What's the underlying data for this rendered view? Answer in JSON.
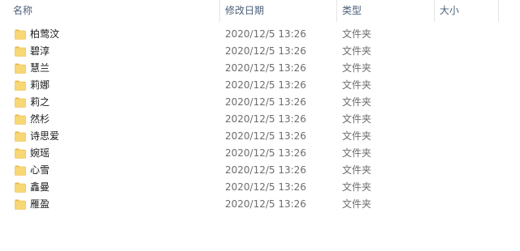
{
  "columns": {
    "name": "名称",
    "modified": "修改日期",
    "type": "类型",
    "size": "大小"
  },
  "colors": {
    "header_text": "#4c607a",
    "folder_body": "#f8d775",
    "folder_tab": "#e8b84a"
  },
  "rows": [
    {
      "name": "柏莺汶",
      "modified": "2020/12/5 13:26",
      "type": "文件夹",
      "icon": "folder-icon"
    },
    {
      "name": "碧淳",
      "modified": "2020/12/5 13:26",
      "type": "文件夹",
      "icon": "folder-icon"
    },
    {
      "name": "慧兰",
      "modified": "2020/12/5 13:26",
      "type": "文件夹",
      "icon": "folder-icon"
    },
    {
      "name": "莉娜",
      "modified": "2020/12/5 13:26",
      "type": "文件夹",
      "icon": "folder-icon"
    },
    {
      "name": "莉之",
      "modified": "2020/12/5 13:26",
      "type": "文件夹",
      "icon": "folder-icon"
    },
    {
      "name": "然杉",
      "modified": "2020/12/5 13:26",
      "type": "文件夹",
      "icon": "folder-icon"
    },
    {
      "name": "诗思爱",
      "modified": "2020/12/5 13:26",
      "type": "文件夹",
      "icon": "folder-icon"
    },
    {
      "name": "婉瑶",
      "modified": "2020/12/5 13:26",
      "type": "文件夹",
      "icon": "folder-icon"
    },
    {
      "name": "心雪",
      "modified": "2020/12/5 13:26",
      "type": "文件夹",
      "icon": "folder-icon"
    },
    {
      "name": "鑫曼",
      "modified": "2020/12/5 13:26",
      "type": "文件夹",
      "icon": "folder-icon"
    },
    {
      "name": "雁盈",
      "modified": "2020/12/5 13:26",
      "type": "文件夹",
      "icon": "folder-icon"
    }
  ]
}
